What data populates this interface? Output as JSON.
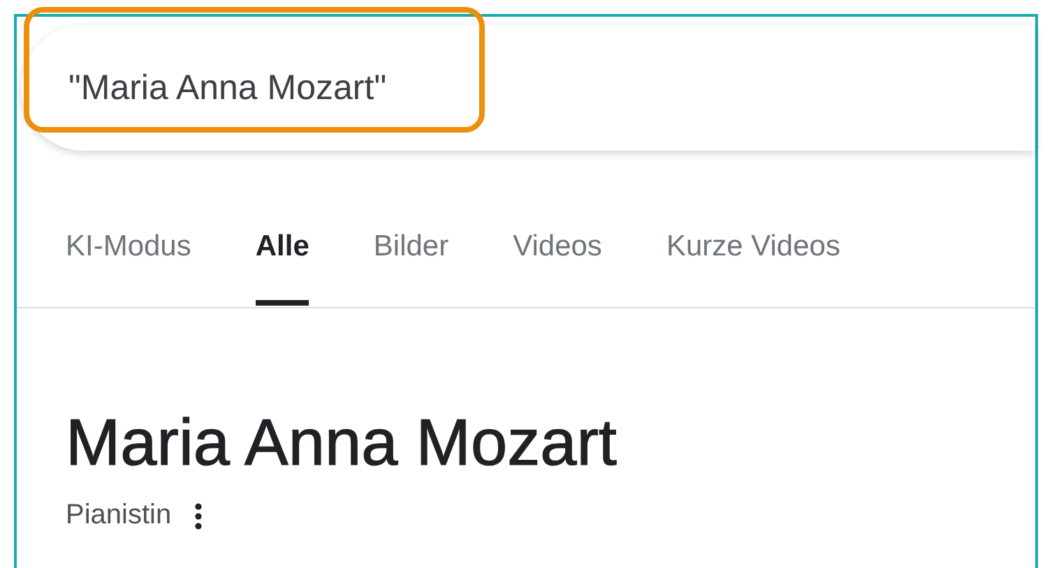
{
  "search": {
    "value": "\"Maria Anna Mozart\"",
    "highlighted": true
  },
  "tabs": [
    {
      "label": "KI-Modus",
      "selected": false
    },
    {
      "label": "Alle",
      "selected": true
    },
    {
      "label": "Bilder",
      "selected": false
    },
    {
      "label": "Videos",
      "selected": false
    },
    {
      "label": "Kurze Videos",
      "selected": false
    }
  ],
  "entity": {
    "title": "Maria Anna Mozart",
    "subtitle": "Pianistin"
  }
}
